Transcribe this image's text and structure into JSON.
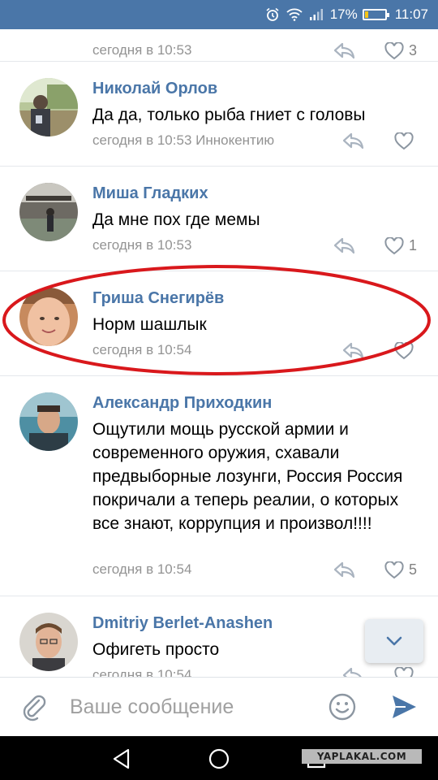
{
  "status_bar": {
    "battery_text": "17%",
    "battery_level": 0.17,
    "time": "11:07",
    "icons": [
      "alarm-icon",
      "wifi-icon",
      "signal-icon",
      "battery-icon"
    ]
  },
  "comments": [
    {
      "author": "",
      "text": "",
      "timestamp": "сегодня в 10:53",
      "likes": "3"
    },
    {
      "author": "Николай Орлов",
      "text": "Да да, только рыба гниет с головы",
      "timestamp": "сегодня в 10:53 Иннокентию",
      "likes": ""
    },
    {
      "author": "Миша Гладких",
      "text": "Да мне пох где мемы",
      "timestamp": "сегодня в 10:53",
      "likes": "1"
    },
    {
      "author": "Гриша Снегирёв",
      "text": "Норм шашлык",
      "timestamp": "сегодня в 10:54",
      "likes": ""
    },
    {
      "author": "Александр Приходкин",
      "text": "Ощутили мощь русской армии и современного оружия, схавали предвыборные лозунги, Россия Россия покричали а теперь реалии, о которых все знают, коррупция и произвол!!!!",
      "timestamp": "сегодня в 10:54",
      "likes": "5"
    },
    {
      "author": "Dmitriy Berlet-Anashen",
      "text": "Офигеть просто",
      "timestamp": "сегодня в 10:54",
      "likes": ""
    }
  ],
  "composer": {
    "placeholder": "Ваше сообщение"
  },
  "watermark": "YAPLAKAL.COM",
  "colors": {
    "accent": "#4a76a8",
    "highlight": "#d9181c",
    "meta": "#939393"
  }
}
